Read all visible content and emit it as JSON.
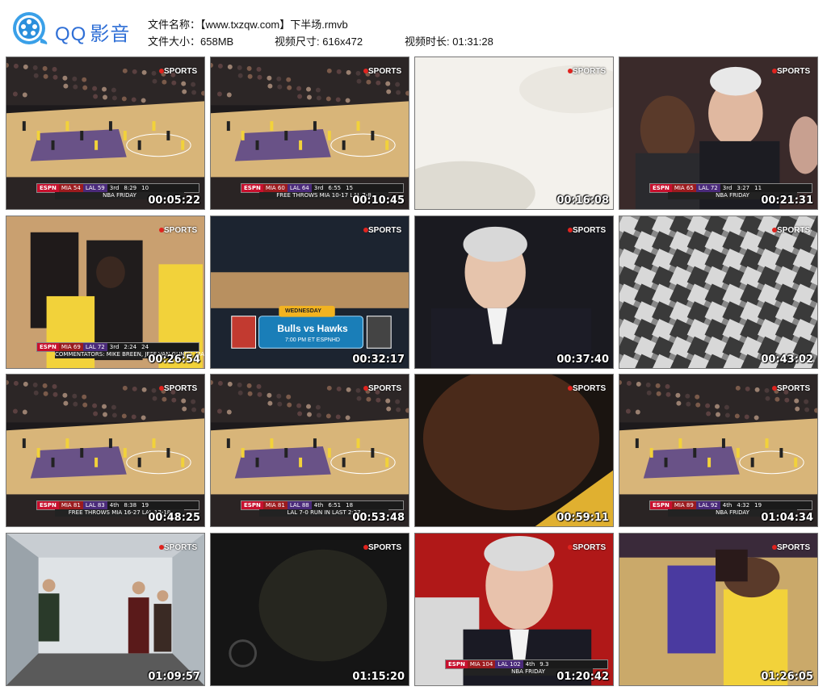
{
  "app": {
    "logo_text": "QQ影音",
    "logo_q": "QQ",
    "logo_cn": "影音"
  },
  "file_info": {
    "name_label": "文件名称：",
    "name_value": "【www.txzqw.com】下半场.rmvb",
    "size_label": "文件大小：",
    "size_value": "658MB",
    "dims_label": "视频尺寸:",
    "dims_value": "616x472",
    "duration_label": "视频时长:",
    "duration_value": "01:31:28"
  },
  "thumbnails": [
    {
      "time": "00:05:22",
      "scene": "court",
      "score": {
        "mia": "54",
        "lal": "59",
        "q": "3rd",
        "clock": "8:29",
        "sc": "10"
      },
      "sub": "NBA FRIDAY"
    },
    {
      "time": "00:10:45",
      "scene": "court",
      "score": {
        "mia": "60",
        "lal": "64",
        "q": "3rd",
        "clock": "6:55",
        "sc": "15"
      },
      "sub": "FREE THROWS   MIA 10-17   LAL 7-8"
    },
    {
      "time": "00:16:08",
      "scene": "white"
    },
    {
      "time": "00:21:31",
      "scene": "crowd",
      "score": {
        "mia": "65",
        "lal": "72",
        "q": "3rd",
        "clock": "3:27",
        "sc": "11"
      },
      "sub": "NBA FRIDAY"
    },
    {
      "time": "00:26:54",
      "scene": "closeup",
      "score": {
        "mia": "69",
        "lal": "72",
        "q": "3rd",
        "clock": "2:24",
        "sc": "24"
      },
      "sub": "COMMENTATORS: MIKE BREEN, JEFF VAN GUNDY, MARK JACKSON"
    },
    {
      "time": "00:32:17",
      "scene": "promo",
      "promo": {
        "day": "WEDNESDAY",
        "teams": "Bulls vs Hawks",
        "time": "7:00 PM ET ESPNHD"
      }
    },
    {
      "time": "00:37:40",
      "scene": "coach"
    },
    {
      "time": "00:43:02",
      "scene": "checker"
    },
    {
      "time": "00:48:25",
      "scene": "court2",
      "score": {
        "mia": "81",
        "lal": "83",
        "q": "4th",
        "clock": "8:38",
        "sc": "19"
      },
      "sub": "FREE THROWS   MIA 16-27   LAL 17-18"
    },
    {
      "time": "00:53:48",
      "scene": "court2",
      "score": {
        "mia": "81",
        "lal": "88",
        "q": "4th",
        "clock": "6:51",
        "sc": "18"
      },
      "sub": "LAL 7-0 RUN IN LAST 2:27"
    },
    {
      "time": "00:59:11",
      "scene": "dark-closeup"
    },
    {
      "time": "01:04:34",
      "scene": "court3",
      "score": {
        "mia": "89",
        "lal": "92",
        "q": "4th",
        "clock": "4:32",
        "sc": "19"
      },
      "sub": "NBA FRIDAY"
    },
    {
      "time": "01:09:57",
      "scene": "room"
    },
    {
      "time": "01:15:20",
      "scene": "dark"
    },
    {
      "time": "01:20:42",
      "scene": "coach2",
      "score": {
        "mia": "104",
        "lal": "102",
        "q": "4th",
        "clock": "9.3",
        "sc": ""
      },
      "sub": "NBA FRIDAY"
    },
    {
      "time": "01:26:05",
      "scene": "action"
    }
  ],
  "labels": {
    "sports_badge": "SPORTS",
    "espn": "ESPN",
    "mia": "MIA",
    "lal": "LAL"
  }
}
